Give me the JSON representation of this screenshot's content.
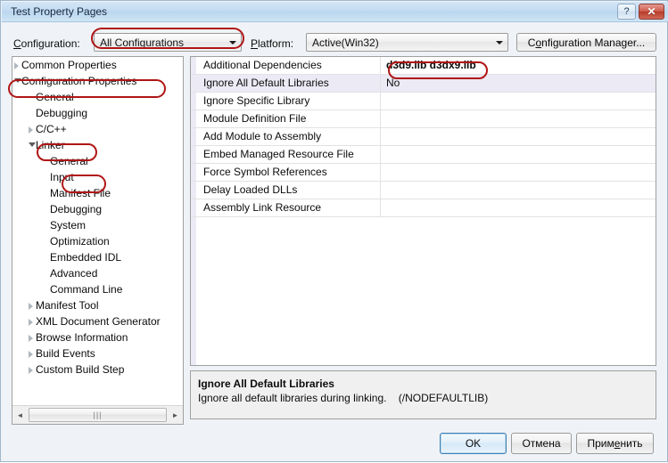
{
  "window": {
    "title": "Test Property Pages",
    "help_button": "?",
    "close_button": "✕"
  },
  "toolbar": {
    "configuration_label": "Configuration:",
    "configuration_value": "All Configurations",
    "platform_label": "Platform:",
    "platform_value": "Active(Win32)",
    "configuration_manager_button": "Configuration Manager..."
  },
  "tree": {
    "items": [
      {
        "label": "Common Properties",
        "indent": 10,
        "toggle": "collapsed",
        "selected": false
      },
      {
        "label": "Configuration Properties",
        "indent": 10,
        "toggle": "expanded",
        "selected": false
      },
      {
        "label": "General",
        "indent": 26,
        "toggle": "none",
        "selected": false
      },
      {
        "label": "Debugging",
        "indent": 26,
        "toggle": "none",
        "selected": false
      },
      {
        "label": "C/C++",
        "indent": 26,
        "toggle": "collapsed",
        "selected": false
      },
      {
        "label": "Linker",
        "indent": 26,
        "toggle": "expanded",
        "selected": false
      },
      {
        "label": "General",
        "indent": 42,
        "toggle": "none",
        "selected": false
      },
      {
        "label": "Input",
        "indent": 42,
        "toggle": "none",
        "selected": true
      },
      {
        "label": "Manifest File",
        "indent": 42,
        "toggle": "none",
        "selected": false
      },
      {
        "label": "Debugging",
        "indent": 42,
        "toggle": "none",
        "selected": false
      },
      {
        "label": "System",
        "indent": 42,
        "toggle": "none",
        "selected": false
      },
      {
        "label": "Optimization",
        "indent": 42,
        "toggle": "none",
        "selected": false
      },
      {
        "label": "Embedded IDL",
        "indent": 42,
        "toggle": "none",
        "selected": false
      },
      {
        "label": "Advanced",
        "indent": 42,
        "toggle": "none",
        "selected": false
      },
      {
        "label": "Command Line",
        "indent": 42,
        "toggle": "none",
        "selected": false
      },
      {
        "label": "Manifest Tool",
        "indent": 26,
        "toggle": "collapsed",
        "selected": false
      },
      {
        "label": "XML Document Generator",
        "indent": 26,
        "toggle": "collapsed",
        "selected": false
      },
      {
        "label": "Browse Information",
        "indent": 26,
        "toggle": "collapsed",
        "selected": false
      },
      {
        "label": "Build Events",
        "indent": 26,
        "toggle": "collapsed",
        "selected": false
      },
      {
        "label": "Custom Build Step",
        "indent": 26,
        "toggle": "collapsed",
        "selected": false
      }
    ],
    "scrollbar": {
      "left_arrow": "◄",
      "right_arrow": "►",
      "thumb_grip": "|||"
    }
  },
  "grid": {
    "rows": [
      {
        "name": "Additional Dependencies",
        "value": "d3d9.lib d3dx9.lib",
        "selected": false,
        "bold_value": true
      },
      {
        "name": "Ignore All Default Libraries",
        "value": "No",
        "selected": true,
        "bold_value": false
      },
      {
        "name": "Ignore Specific Library",
        "value": "",
        "selected": false,
        "bold_value": false
      },
      {
        "name": "Module Definition File",
        "value": "",
        "selected": false,
        "bold_value": false
      },
      {
        "name": "Add Module to Assembly",
        "value": "",
        "selected": false,
        "bold_value": false
      },
      {
        "name": "Embed Managed Resource File",
        "value": "",
        "selected": false,
        "bold_value": false
      },
      {
        "name": "Force Symbol References",
        "value": "",
        "selected": false,
        "bold_value": false
      },
      {
        "name": "Delay Loaded DLLs",
        "value": "",
        "selected": false,
        "bold_value": false
      },
      {
        "name": "Assembly Link Resource",
        "value": "",
        "selected": false,
        "bold_value": false
      }
    ]
  },
  "description": {
    "title": "Ignore All Default Libraries",
    "body": "Ignore all default libraries during linking.    (/NODEFAULTLIB)"
  },
  "footer": {
    "ok_button": "OK",
    "cancel_button": "Отмена",
    "apply_button": "Применить"
  },
  "annotations": {
    "color": "#b01616",
    "circled": [
      "All Configurations",
      "Configuration Properties",
      "Linker",
      "Input",
      "d3d9.lib d3dx9.lib"
    ]
  }
}
